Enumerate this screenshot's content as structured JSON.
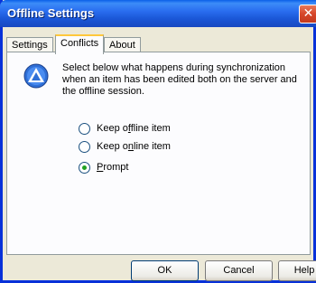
{
  "window": {
    "title": "Offline Settings"
  },
  "tabs": [
    {
      "label": "Settings"
    },
    {
      "label": "Conflicts"
    },
    {
      "label": "About"
    }
  ],
  "conflicts": {
    "description": "Select below what happens during synchronization when an item has been edited both on the server and the offline session.",
    "options": [
      {
        "pre": "Keep o",
        "u": "f",
        "post": "fline item",
        "checked": false
      },
      {
        "pre": "Keep o",
        "u": "n",
        "post": "line item",
        "checked": false
      },
      {
        "pre": "",
        "u": "P",
        "post": "rompt",
        "checked": true
      }
    ]
  },
  "buttons": {
    "ok": "OK",
    "cancel": "Cancel",
    "help": "Help"
  },
  "icons": {
    "close": "close-icon",
    "info": "info-icon"
  },
  "colors": {
    "titlebar": "#2a6ef0",
    "close": "#d6462a",
    "tab_highlight": "#ffc83c"
  }
}
